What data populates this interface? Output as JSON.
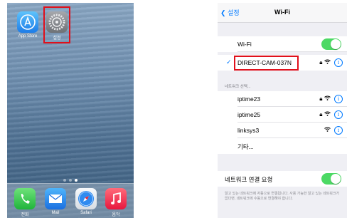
{
  "home": {
    "apps": [
      {
        "label": "App Store",
        "icon": "app-store-icon"
      },
      {
        "label": "설정",
        "icon": "settings-gear-icon"
      }
    ],
    "dock": [
      {
        "label": "전화",
        "icon": "phone-icon"
      },
      {
        "label": "Mail",
        "icon": "mail-icon"
      },
      {
        "label": "Safari",
        "icon": "safari-compass-icon"
      },
      {
        "label": "음악",
        "icon": "music-note-icon"
      }
    ]
  },
  "wifi": {
    "back_label": "설정",
    "title": "Wi-Fi",
    "wifi_label": "Wi-Fi",
    "wifi_on": true,
    "connected_network": "DIRECT-CAM-037N",
    "choose_network_label": "네트워크 선택...",
    "networks": [
      {
        "name": "iptime23",
        "locked": true
      },
      {
        "name": "iptime25",
        "locked": true
      },
      {
        "name": "linksys3",
        "locked": false
      }
    ],
    "other_label": "기타...",
    "ask_to_join_label": "네트워크 연결 요청",
    "ask_to_join_on": true,
    "footer_text": "알고 있는 네트워크에 자동으로 연결됩니다. 사용 가능한 알고 있는 네트워크가 없다면, 네트워크에 수동으로 연결해야 합니다."
  },
  "colors": {
    "accent": "#007aff",
    "toggle_on": "#4cd964",
    "highlight": "#e0101b"
  }
}
